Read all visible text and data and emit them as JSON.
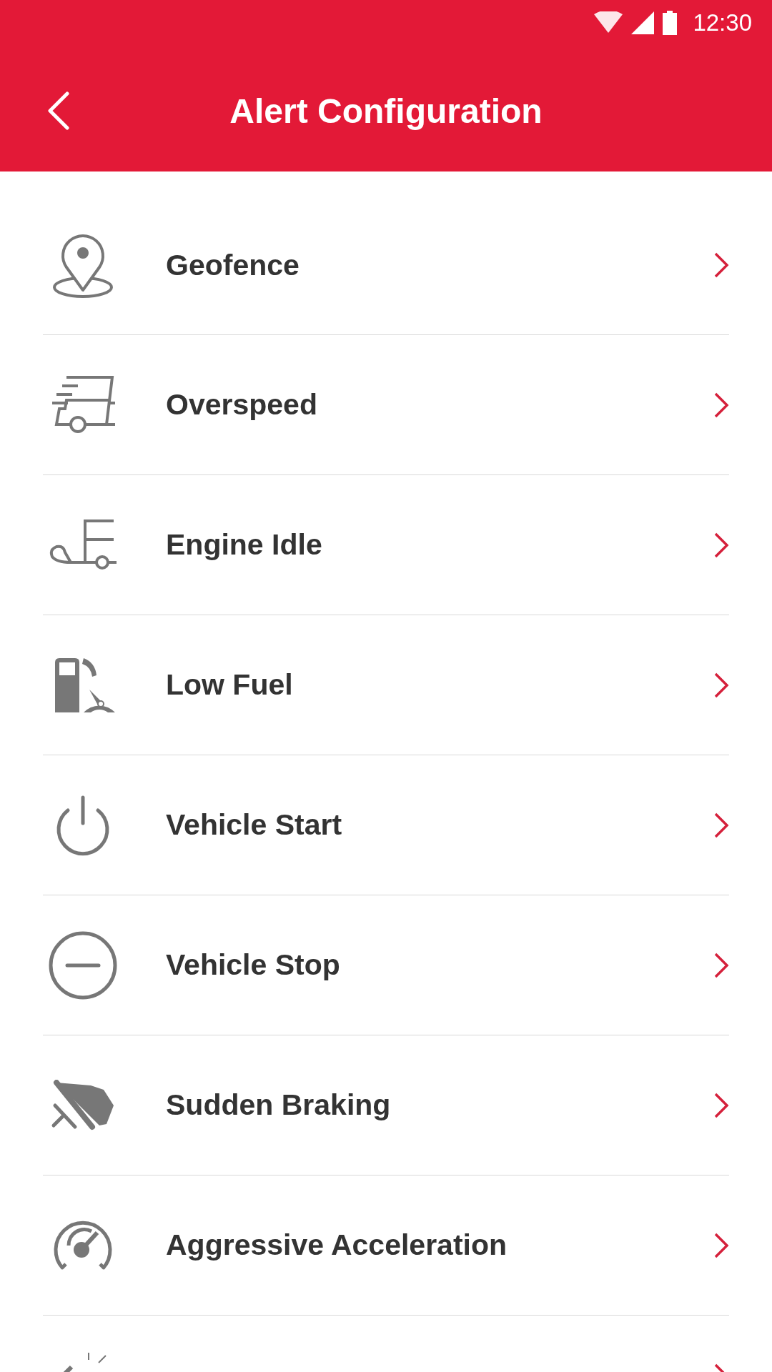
{
  "status_bar": {
    "time": "12:30"
  },
  "header": {
    "title": "Alert Configuration"
  },
  "items": [
    {
      "label": "Geofence"
    },
    {
      "label": "Overspeed"
    },
    {
      "label": "Engine Idle"
    },
    {
      "label": "Low Fuel"
    },
    {
      "label": "Vehicle Start"
    },
    {
      "label": "Vehicle Stop"
    },
    {
      "label": "Sudden Braking"
    },
    {
      "label": "Aggressive Acceleration"
    }
  ]
}
